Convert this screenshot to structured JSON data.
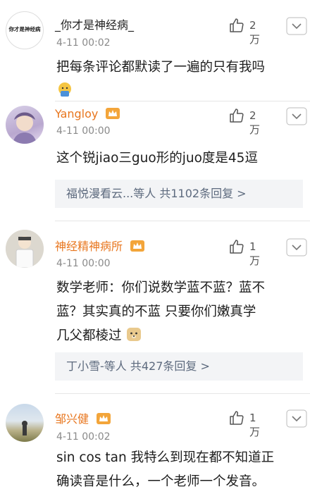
{
  "comments": [
    {
      "username": "_你才是神经病_",
      "avatar_text": "你才是神经病",
      "time": "4-11 00:02",
      "likes": "2万",
      "text": "把每条评论都默读了一遍的只有我吗",
      "vip": false
    },
    {
      "username": "Yangloy",
      "time": "4-11 00:00",
      "likes": "2万",
      "text": "这个锐jiao三guo形的juo度是45逗",
      "replies": "福悦漫看云...等人  共1102条回复 >",
      "vip": true
    },
    {
      "username": "神经精神病所",
      "time": "4-11 00:00",
      "likes": "1万",
      "text_line1": "数学老师：你们说数学蓝不蓝？蓝不",
      "text_line2": "蓝？其实真的不蓝 只要你们嫩真学",
      "text_line3": "几父都棱过",
      "replies": "丁小雪-等人  共427条回复 >",
      "vip": true
    },
    {
      "username": "邹兴健",
      "time": "4-11 00:02",
      "likes": "1万",
      "text_line1": "sin cos tan 我特么到现在都不知道正",
      "text_line2": "确读音是什么，一个老师一个发音。",
      "vip": true
    }
  ],
  "colors": {
    "vip_name": "#e8761e",
    "reply_bg": "#f3f4f6",
    "reply_text": "#5d6a7e"
  }
}
